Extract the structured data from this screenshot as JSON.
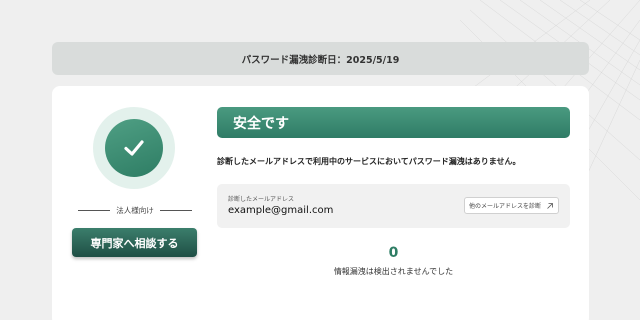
{
  "header": {
    "diagnosis_date": "パスワード漏洩診断日：2025/5/19"
  },
  "sidebar": {
    "corporate_label": "法人様向け",
    "consult_button": "専門家へ相談する"
  },
  "result": {
    "status_title": "安全です",
    "message": "診断したメールアドレスで利用中のサービスにおいてパスワード漏洩はありません。",
    "email_label": "診断したメールアドレス",
    "email_value": "example@gmail.com",
    "other_email_button": "他のメールアドレスを診断",
    "leak_count": "0",
    "leak_count_label": "情報漏洩は検出されませんでした"
  },
  "colors": {
    "accent": "#2e7d64",
    "button_dark": "#1f4f45"
  }
}
